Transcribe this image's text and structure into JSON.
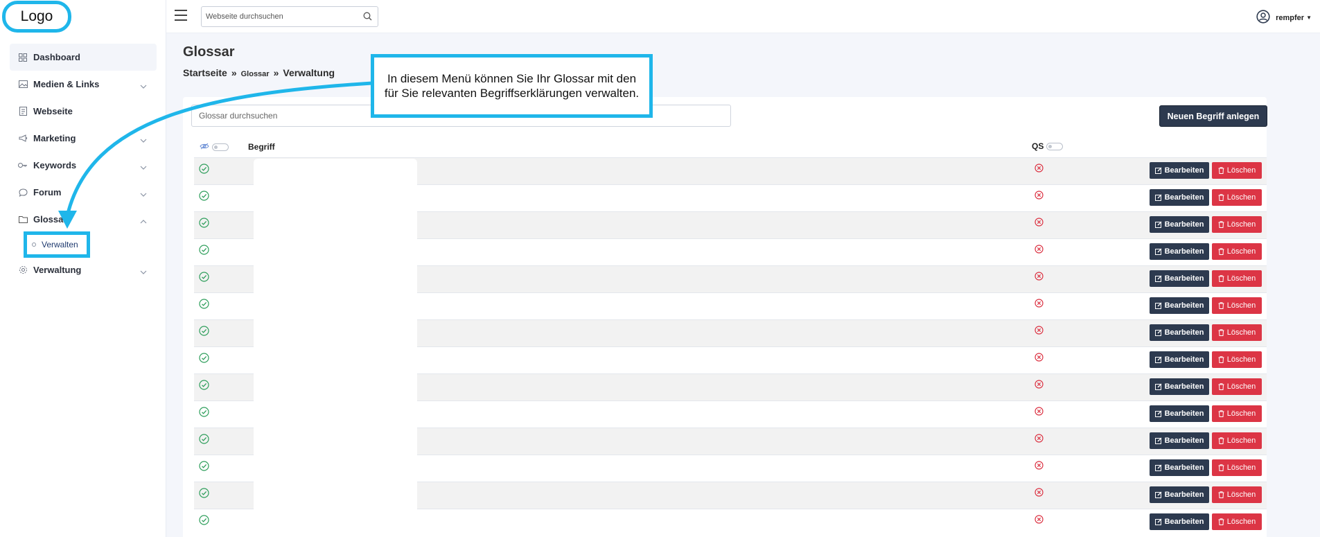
{
  "logo": {
    "text": "Logo"
  },
  "topbar": {
    "search_placeholder": "Webseite durchsuchen",
    "username": "rempfer"
  },
  "sidebar": {
    "items": [
      {
        "label": "Dashboard"
      },
      {
        "label": "Medien & Links"
      },
      {
        "label": "Webseite"
      },
      {
        "label": "Marketing"
      },
      {
        "label": "Keywords"
      },
      {
        "label": "Forum"
      },
      {
        "label": "Glossar"
      },
      {
        "label": "Verwaltung"
      }
    ],
    "subitem": {
      "label": "Verwalten"
    }
  },
  "page": {
    "title": "Glossar",
    "breadcrumb": {
      "home": "Startseite",
      "section": "Glossar",
      "current": "Verwaltung",
      "separator": "»"
    }
  },
  "glossary": {
    "search_placeholder": "Glossar durchsuchen",
    "new_button": "Neuen Begriff anlegen",
    "columns": {
      "term": "Begriff",
      "qs": "QS"
    },
    "edit_label": "Bearbeiten",
    "delete_label": "Löschen",
    "row_count": 14
  },
  "callout": {
    "text": "In diesem Menü können Sie Ihr Glossar mit den für Sie relevanten Begriffserklärungen verwalten."
  },
  "colors": {
    "accent": "#1fb6ea",
    "primary_button": "#2d3a4f",
    "danger_button": "#dc3545",
    "success": "#2e9e5b"
  }
}
